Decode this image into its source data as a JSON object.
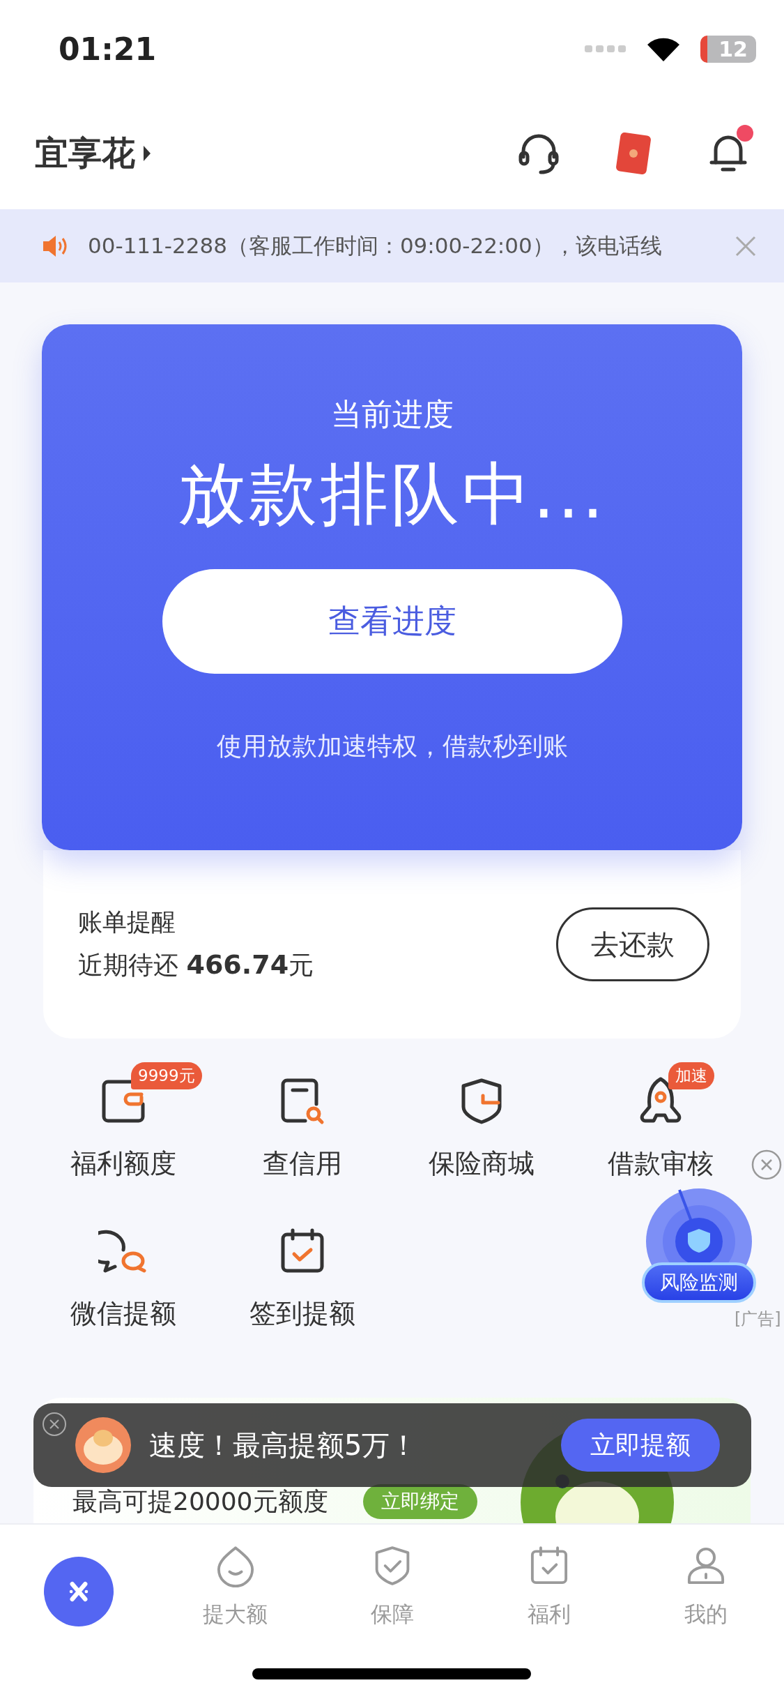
{
  "status_bar": {
    "time": "01:21",
    "battery": "12"
  },
  "header": {
    "title": "宜享花",
    "notification_dot": true
  },
  "notice": {
    "text": "00-111-2288（客服工作时间：09:00-22:00），该电话线"
  },
  "progress_card": {
    "label": "当前进度",
    "status": "放款排队中...",
    "button": "查看进度",
    "hint": "使用放款加速特权，借款秒到账"
  },
  "bill": {
    "title": "账单提醒",
    "text": "近期待还 **466.74**元",
    "button": "去还款"
  },
  "shortcuts": [
    {
      "kind": "wallet",
      "label": "福利额度",
      "badge": "9999元"
    },
    {
      "kind": "doc-search",
      "label": "查信用"
    },
    {
      "kind": "shield",
      "label": "保险商城"
    },
    {
      "kind": "rocket",
      "label": "借款审核",
      "badge": "加速"
    },
    {
      "kind": "chat",
      "label": "微信提额"
    },
    {
      "kind": "calendar",
      "label": "签到提额"
    }
  ],
  "float_ad": {
    "label": "风险监测",
    "tag": "[广告]"
  },
  "banner": {
    "subtitle": "最高可提20000元额度",
    "button": "立即绑定"
  },
  "toast": {
    "text": "速度！最高提额5万！",
    "button": "立即提额"
  },
  "tab_bar": [
    {
      "kind": "home",
      "selected": true
    },
    {
      "kind": "drop",
      "label": "提大额",
      "selected": false
    },
    {
      "kind": "shield",
      "label": "保障",
      "selected": false
    },
    {
      "kind": "calendar",
      "label": "福利",
      "selected": false
    },
    {
      "kind": "person",
      "label": "我的",
      "selected": false
    }
  ]
}
